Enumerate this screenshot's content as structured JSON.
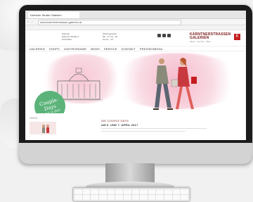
{
  "browser": {
    "tab_title": "Kärntner Straße Galerien",
    "address": "www.kaerntnerstrasse-galerien.at",
    "bookmarks": [
      "Favoriten",
      "Galerien",
      "Shops",
      "Gastronomie",
      "Service"
    ]
  },
  "site": {
    "contact_left": [
      "Adresse",
      "Kärntner Straße 9",
      "1010 Wien"
    ],
    "contact_mid": [
      "Öffnungszeiten",
      "Mo – Fr 10 – 20",
      "Sa 10 – 18"
    ],
    "brand_name_line1": "KÄRNTNERSTRASSEN",
    "brand_name_line2": "GALERIEN",
    "brand_sub": "Mode · Genuss · Wien",
    "brand_mark": "K",
    "nav": [
      "GALERIEN",
      "SHOPS",
      "GASTRONOMIE",
      "NEWS",
      "SERVICE",
      "KONTAKT",
      "PRESSE/MEDIA"
    ]
  },
  "hero": {
    "badge_title": "Couple-Days",
    "badge_date": "6. & 7. 4. 2017"
  },
  "news": {
    "label": "NEWS",
    "article_title": "DIE COUPLE DAYS",
    "article_date": "AM 6. UND 7. APRIL 2017"
  },
  "colors": {
    "accent_green": "#5cb37a",
    "brand_red": "#c51d1d",
    "wash_pink": "#f4b8c8"
  }
}
